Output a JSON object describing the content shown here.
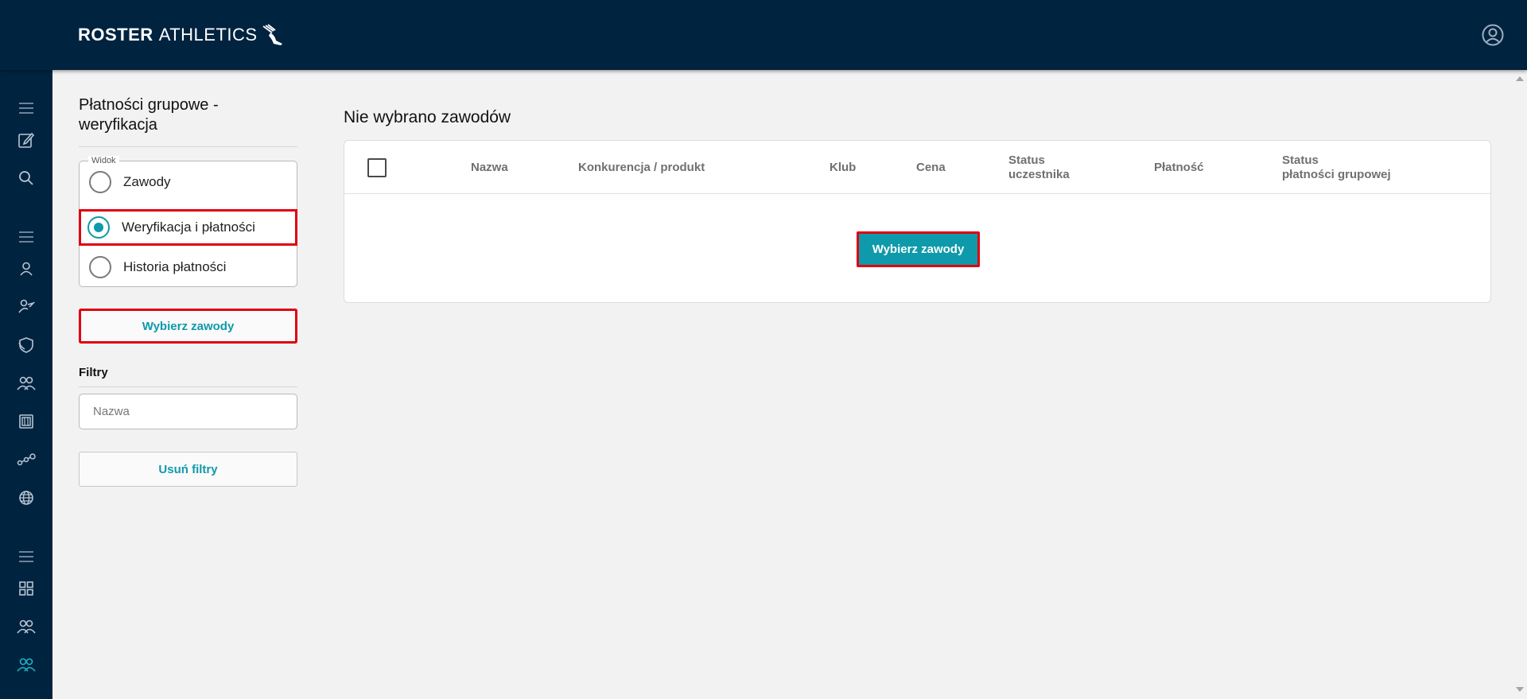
{
  "header": {
    "logo_bold": "ROSTER",
    "logo_light": "ATHLETICS",
    "logo_icon": "winged-shoe-icon",
    "account_icon": "user-circle-icon"
  },
  "sidebar": {
    "icons": [
      "menu-icon",
      "edit-icon",
      "search-icon",
      "menu-icon",
      "user-icon",
      "coach-icon",
      "shield-icon",
      "users-icon",
      "calendar-icon",
      "connections-icon",
      "globe-icon",
      "menu-icon",
      "grid-icon",
      "users-icon",
      "users-active-icon"
    ]
  },
  "left_panel": {
    "title": "Płatności grupowe - weryfikacja",
    "view_legend": "Widok",
    "options": [
      {
        "label": "Zawody",
        "checked": false
      },
      {
        "label": "Weryfikacja i płatności",
        "checked": true
      },
      {
        "label": "Historia płatności",
        "checked": false
      }
    ],
    "select_button": "Wybierz zawody",
    "filters_title": "Filtry",
    "name_placeholder": "Nazwa",
    "clear_filters": "Usuń filtry"
  },
  "main": {
    "title": "Nie wybrano zawodów",
    "columns": {
      "name": "Nazwa",
      "event": "Konkurencja / produkt",
      "club": "Klub",
      "price": "Cena",
      "status_l1": "Status",
      "status_l2": "uczestnika",
      "payment": "Płatność",
      "group_l1": "Status",
      "group_l2": "płatności grupowej"
    },
    "select_button": "Wybierz zawody"
  },
  "colors": {
    "navy": "#002340",
    "accent": "#0e9aaa",
    "highlight": "#e00010"
  }
}
